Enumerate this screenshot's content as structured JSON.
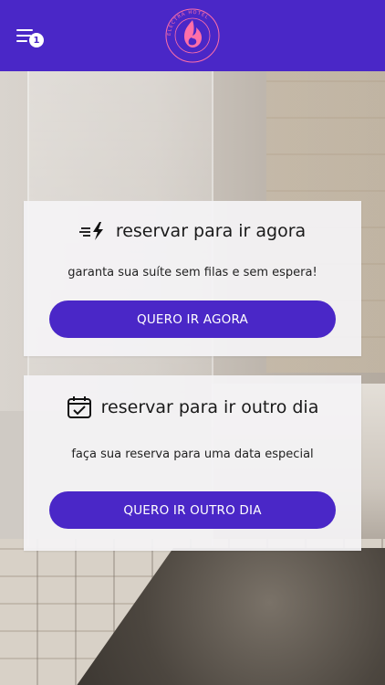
{
  "header": {
    "menu_badge_count": "1",
    "menu_icon": "menu-lines-icon",
    "logo_icon": "electra-hotel-flame-logo",
    "logo_text": "ELECTRA HOTEL"
  },
  "cards": [
    {
      "icon": "lightning-fast-icon",
      "title": "reservar para ir agora",
      "subtitle": "garanta sua suíte sem filas e sem espera!",
      "button_label": "QUERO IR AGORA"
    },
    {
      "icon": "calendar-check-icon",
      "title": "reservar para ir outro dia",
      "subtitle": "faça sua reserva para uma data especial",
      "button_label": "QUERO IR OUTRO DIA"
    }
  ],
  "colors": {
    "brand": "#4a27c7",
    "logo_pink": "#ff6fa8",
    "card_bg": "#f4f3f5"
  }
}
